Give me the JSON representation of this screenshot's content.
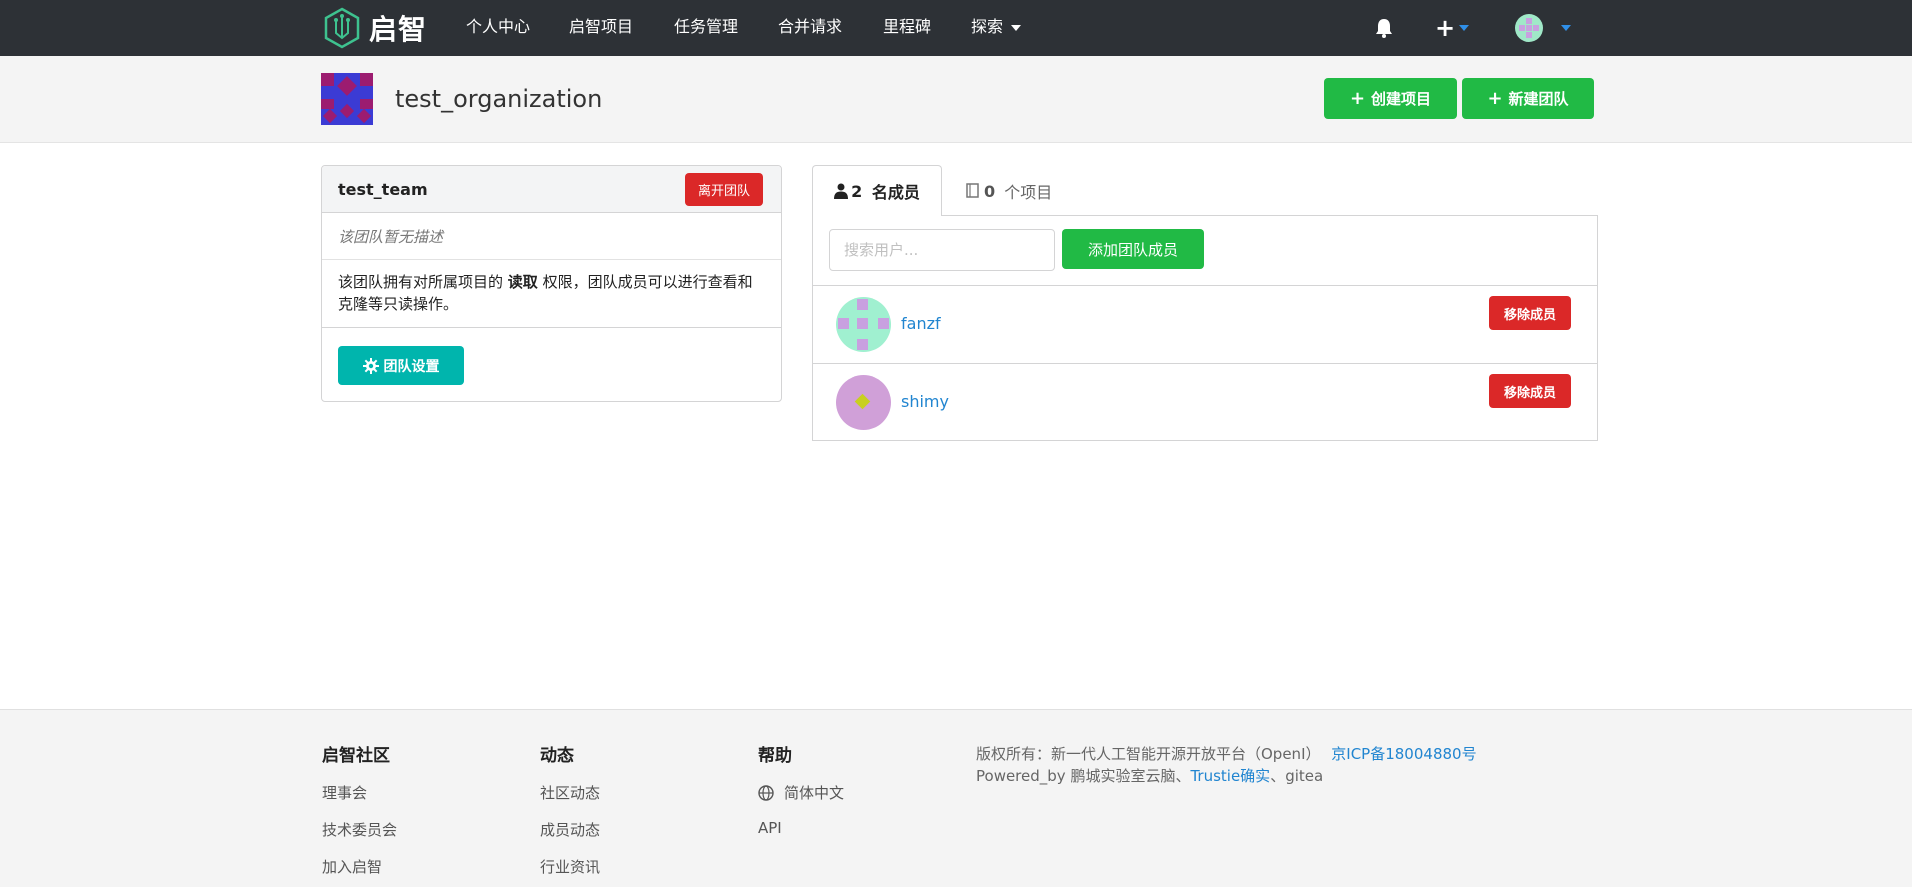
{
  "nav": {
    "brand": "启智",
    "items": [
      "个人中心",
      "启智项目",
      "任务管理",
      "合并请求",
      "里程碑"
    ],
    "explore": "探索"
  },
  "org": {
    "name": "test_organization",
    "create_project": "创建项目",
    "create_team": "新建团队"
  },
  "team": {
    "name": "test_team",
    "leave": "离开团队",
    "description": "该团队暂无描述",
    "perm_prefix": "该团队拥有对所属项目的 ",
    "perm_bold": "读取",
    "perm_suffix": " 权限，团队成员可以进行查看和克隆等只读操作。",
    "settings": "团队设置"
  },
  "tabs": {
    "members_count": "2",
    "members_label": "名成员",
    "projects_count": "0",
    "projects_label": "个项目"
  },
  "members": {
    "search_placeholder": "搜索用户...",
    "add_button": "添加团队成员",
    "remove_label": "移除成员",
    "list": [
      {
        "name": "fanzf"
      },
      {
        "name": "shimy"
      }
    ]
  },
  "footer": {
    "col1_title": "启智社区",
    "col1_links": [
      "理事会",
      "技术委员会",
      "加入启智"
    ],
    "col2_title": "动态",
    "col2_links": [
      "社区动态",
      "成员动态",
      "行业资讯"
    ],
    "col3_title": "帮助",
    "col3_links": [
      "简体中文",
      "API"
    ],
    "copyright": "版权所有：新一代人工智能开源开放平台（OpenI）",
    "icp": "京ICP备18004880号",
    "powered_prefix": "Powered_by 鹏城实验室云脑、",
    "trustie": "Trustie确实",
    "powered_suffix": "、gitea"
  },
  "colors": {
    "nav_bg": "#2d3136",
    "green": "#21ba45",
    "red": "#db2828",
    "teal": "#00b5ad",
    "link": "#2185d0"
  }
}
